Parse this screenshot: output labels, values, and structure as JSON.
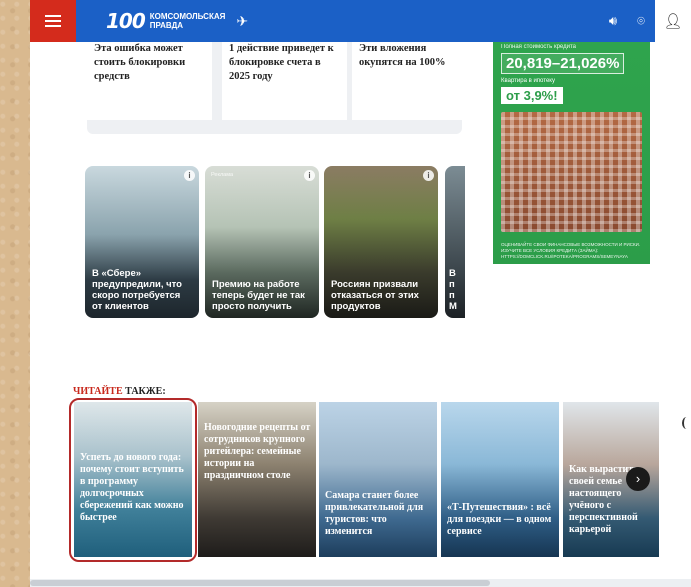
{
  "header": {
    "logo_number": "100",
    "logo_line1": "Комсомольская",
    "logo_line2": "правда"
  },
  "top_articles": [
    {
      "title": "Эта ошибка может стоить блокировки средств"
    },
    {
      "title": "1 действие приведет к блокировке счета в 2025 году"
    },
    {
      "title": "Эти вложения окупятся на 100%"
    }
  ],
  "side_ad": {
    "line1": "Полная стоимость кредита",
    "range": "20,819–21,026%",
    "line2": "Квартира в ипотеку",
    "rate": "от 3,9%!",
    "footnote": "ОЦЕНИВАЙТЕ СВОИ ФИНАНСОВЫЕ ВОЗМОЖНОСТИ И РИСКИ. ИЗУЧИТЕ ВСЕ УСЛОВИЯ КРЕДИТА (ЗАЙМА): HTTPS://DOMCLICK.RU/IPOTEKA/PROGRAMS/SEMEYNAYA"
  },
  "teasers": [
    {
      "label": "",
      "text": "В «Сбере» предупредили, что скоро потребуется от клиентов",
      "badge": "i"
    },
    {
      "label": "Реклама",
      "text": "Премию на работе теперь будет не так просто получить",
      "badge": "i"
    },
    {
      "label": "",
      "text": "Россиян призвали отказаться от этих продуктов",
      "badge": "i"
    },
    {
      "label": "",
      "text": "В п п М",
      "badge": ""
    }
  ],
  "read_also": {
    "part1": "ЧИТАЙТЕ",
    "part2": " ТАКЖЕ:"
  },
  "read_cards": [
    {
      "text": "Успеть до нового года: почему стоит вступить в программу долгосрочных сбережений как можно быстрее"
    },
    {
      "text": "Новогодние рецепты от сотрудников крупного ритейлера: семейные истории на праздничном столе"
    },
    {
      "text": "Самара станет более привлекательной для туристов: что изменится"
    },
    {
      "text": "«Т-Путешествия» : всё для поездки — в одном сервисе"
    },
    {
      "text": "Как вырастить своей семье настоящего учёного с перспективной карьерой"
    }
  ],
  "icons": {
    "menu": "hamburger-icon",
    "sound": "speaker-icon",
    "location": "location-pin-icon",
    "user": "user-icon",
    "next": "chevron-right-icon"
  },
  "colors": {
    "header_blue": "#1b60c6",
    "menu_red": "#d42b1c",
    "ad_green": "#2c9d49",
    "read_also_red": "#c8281c",
    "highlight_border": "#b32a2a"
  }
}
